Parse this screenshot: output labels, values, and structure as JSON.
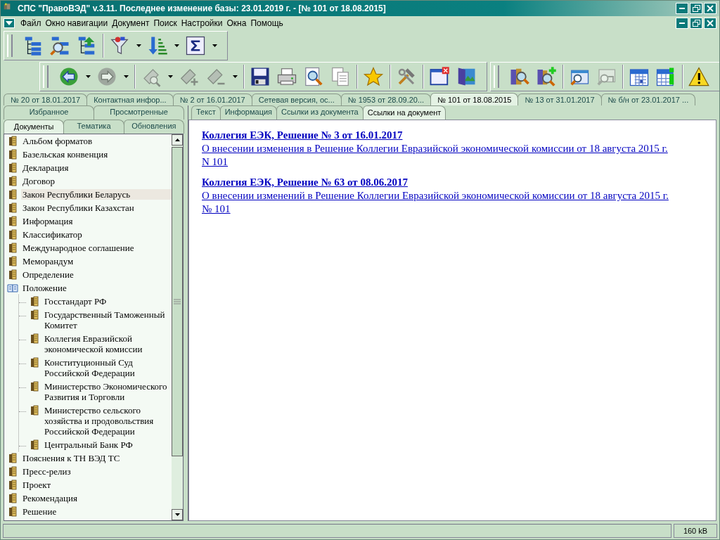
{
  "window": {
    "title": "СПС \"ПравоВЭД\" v.3.11. Последнее изменение базы: 23.01.2019 г. - [№ 101 от 18.08.2015]"
  },
  "menu": [
    "Файл",
    "Окно навигации",
    "Документ",
    "Поиск",
    "Настройки",
    "Окна",
    "Помощь"
  ],
  "toolbar_rows": [
    {
      "toolbars": [
        {
          "groups": [
            [
              {
                "kind": "tree",
                "disabled": false
              },
              {
                "kind": "tree-search",
                "disabled": false
              },
              {
                "kind": "tree-up",
                "disabled": false
              }
            ],
            [
              {
                "kind": "filter",
                "disabled": false
              },
              {
                "kind": "dropdown"
              },
              {
                "kind": "sort",
                "disabled": false
              },
              {
                "kind": "dropdown"
              },
              {
                "kind": "sum",
                "disabled": false
              },
              {
                "kind": "dropdown"
              }
            ]
          ]
        }
      ]
    },
    {
      "toolbars": [
        {
          "groups": [
            [
              {
                "kind": "back",
                "disabled": false
              },
              {
                "kind": "dropdown"
              },
              {
                "kind": "forward",
                "disabled": true
              },
              {
                "kind": "dropdown"
              }
            ],
            [
              {
                "kind": "tag-search",
                "disabled": true
              },
              {
                "kind": "dropdown"
              },
              {
                "kind": "tag-add",
                "disabled": true
              },
              {
                "kind": "tag-remove",
                "disabled": true
              },
              {
                "kind": "dropdown"
              }
            ],
            [
              {
                "kind": "save",
                "disabled": false
              },
              {
                "kind": "print",
                "disabled": false
              },
              {
                "kind": "preview",
                "disabled": false
              },
              {
                "kind": "copy",
                "disabled": false
              }
            ],
            [
              {
                "kind": "star",
                "disabled": false
              }
            ],
            [
              {
                "kind": "tools",
                "disabled": false
              }
            ],
            [
              {
                "kind": "close-window",
                "disabled": false
              },
              {
                "kind": "door",
                "disabled": false
              }
            ]
          ]
        },
        {
          "groups": [
            [
              {
                "kind": "book-search",
                "disabled": false
              },
              {
                "kind": "book-add",
                "disabled": false
              }
            ],
            [
              {
                "kind": "folder-search",
                "disabled": false
              },
              {
                "kind": "window-search",
                "disabled": true
              }
            ],
            [
              {
                "kind": "calendar",
                "disabled": false
              },
              {
                "kind": "calendar-info",
                "disabled": false
              }
            ],
            [
              {
                "kind": "warning",
                "disabled": false
              }
            ]
          ]
        }
      ]
    }
  ],
  "document_tabs": [
    {
      "label": "№ 20 от 18.01.2017",
      "selected": false
    },
    {
      "label": "Контактная инфор...",
      "selected": false
    },
    {
      "label": "№ 2 от 16.01.2017",
      "selected": false
    },
    {
      "label": "Сетевая версия, ос...",
      "selected": false
    },
    {
      "label": "№ 1953 от 28.09.20...",
      "selected": false
    },
    {
      "label": "№ 101 от 18.08.2015",
      "selected": true
    },
    {
      "label": "№ 13 от 31.01.2017",
      "selected": false
    },
    {
      "label": "№ б/н от 23.01.2017 ...",
      "selected": false
    }
  ],
  "sidebar": {
    "tab_rows": [
      [
        {
          "label": "Избранное",
          "selected": false
        },
        {
          "label": "Просмотренные",
          "selected": false
        }
      ],
      [
        {
          "label": "Документы",
          "selected": true
        },
        {
          "label": "Тематика",
          "selected": false
        },
        {
          "label": "Обновления",
          "selected": false
        }
      ]
    ],
    "tree": [
      {
        "label": "Альбом форматов",
        "kind": "book",
        "selected": false
      },
      {
        "label": "Базельская конвенция",
        "kind": "book",
        "selected": false
      },
      {
        "label": "Декларация",
        "kind": "book",
        "selected": false
      },
      {
        "label": "Договор",
        "kind": "book",
        "selected": false
      },
      {
        "label": "Закон Республики Беларусь",
        "kind": "book",
        "selected": true
      },
      {
        "label": "Закон Республики Казахстан",
        "kind": "book",
        "selected": false
      },
      {
        "label": "Информация",
        "kind": "book",
        "selected": false
      },
      {
        "label": "Классификатор",
        "kind": "book",
        "selected": false
      },
      {
        "label": "Международное соглашение",
        "kind": "book",
        "selected": false
      },
      {
        "label": "Меморандум",
        "kind": "book",
        "selected": false
      },
      {
        "label": "Определение",
        "kind": "book",
        "selected": false
      },
      {
        "label": "Положение",
        "kind": "open-book",
        "selected": false,
        "children": [
          {
            "label": "Госстандарт РФ",
            "kind": "book",
            "selected": false
          },
          {
            "label": "Государственный Таможенный Комитет",
            "kind": "book",
            "selected": false
          },
          {
            "label": "Коллегия Евразийской экономической комиссии",
            "kind": "book",
            "selected": false
          },
          {
            "label": "Конституционный Суд Российской Федерации",
            "kind": "book",
            "selected": false
          },
          {
            "label": "Министерство Экономического Развития и Торговли",
            "kind": "book",
            "selected": false
          },
          {
            "label": "Министерство сельского хозяйства и продовольствия Российской Федерации",
            "kind": "book",
            "selected": false
          },
          {
            "label": "Центральный Банк РФ",
            "kind": "book",
            "selected": false
          }
        ]
      },
      {
        "label": "Пояснения к ТН ВЭД ТС",
        "kind": "book",
        "selected": false
      },
      {
        "label": "Пресс-релиз",
        "kind": "book",
        "selected": false
      },
      {
        "label": "Проект",
        "kind": "book",
        "selected": false
      },
      {
        "label": "Рекомендация",
        "kind": "book",
        "selected": false
      },
      {
        "label": "Решение",
        "kind": "book",
        "selected": false
      }
    ]
  },
  "content_tabs": [
    {
      "label": "Текст",
      "selected": false
    },
    {
      "label": "Информация",
      "selected": false
    },
    {
      "label": "Ссылки из документа",
      "selected": false
    },
    {
      "label": "Ссылки на документ",
      "selected": true
    }
  ],
  "links": [
    {
      "title": "Коллегия ЕЭК, Решение № 3 от 16.01.2017",
      "description": "О внесении изменения в Решение Коллегии Евразийской экономической комиссии от 18 августа 2015 г. N 101"
    },
    {
      "title": "Коллегия ЕЭК, Решение № 63 от 08.06.2017",
      "description": "О внесении изменений в Решение Коллегии Евразийской экономической комиссии от 18 августа 2015 г. № 101"
    }
  ],
  "status_bar": {
    "size": "160 kB"
  }
}
